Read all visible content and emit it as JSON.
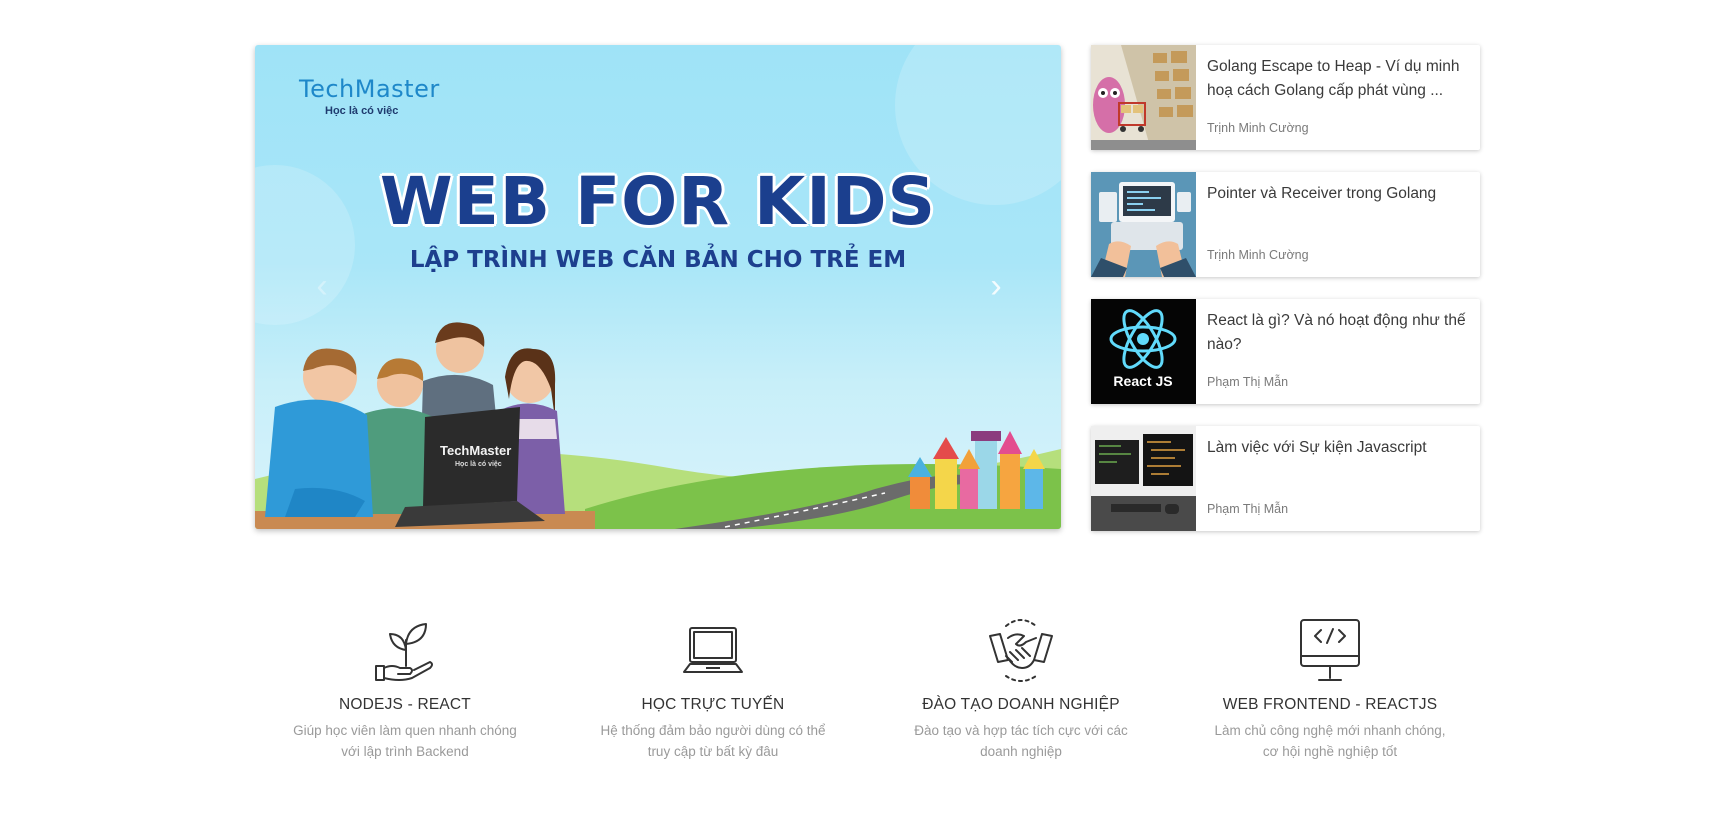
{
  "banner": {
    "brand_name": "TechMaster",
    "brand_tagline": "Học là có việc",
    "title": "WEB FOR KIDS",
    "subtitle": "LẬP TRÌNH WEB CĂN BẢN CHO TRẺ EM",
    "laptop_brand": "TechMaster",
    "laptop_tagline": "Học là có việc",
    "prev_arrow": "‹",
    "next_arrow": "›"
  },
  "articles": [
    {
      "title": "Golang Escape to Heap - Ví dụ minh hoạ cách Golang cấp phát vùng ...",
      "author": "Trịnh Minh Cường",
      "thumb": "warehouse-gopher-illustration"
    },
    {
      "title": "Pointer và Receiver trong Golang",
      "author": "Trịnh Minh Cường",
      "thumb": "laptop-typing-illustration"
    },
    {
      "title": "React là gì? Và nó hoạt động như thế nào?",
      "author": "Phạm Thị Mẫn",
      "thumb": "react-logo",
      "thumb_label": "React JS"
    },
    {
      "title": "Làm việc với Sự kiện Javascript",
      "author": "Phạm Thị Mẫn",
      "thumb": "code-monitors-photo"
    }
  ],
  "features": [
    {
      "icon": "plant-hand-icon",
      "title": "NODEJS - REACT",
      "desc": "Giúp học viên làm quen nhanh chóng với lập trình Backend"
    },
    {
      "icon": "laptop-icon",
      "title": "HỌC TRỰC TUYẾN",
      "desc": "Hệ thống đảm bảo người dùng có thể truy cập từ bất kỳ đâu"
    },
    {
      "icon": "handshake-icon",
      "title": "ĐÀO TẠO DOANH NGHIỆP",
      "desc": "Đào tạo và hợp tác tích cực với các doanh nghiệp"
    },
    {
      "icon": "monitor-code-icon",
      "title": "WEB FRONTEND - REACTJS",
      "desc": "Làm chủ công nghệ mới nhanh chóng, cơ hội nghề nghiệp tốt"
    }
  ],
  "colors": {
    "banner_sky": "#9fe3f7",
    "banner_title": "#1b3f8e",
    "brand_blue": "#1e88c9",
    "text_dark": "#333333",
    "text_muted": "#9a9a9a",
    "react_blue": "#61dafb"
  }
}
